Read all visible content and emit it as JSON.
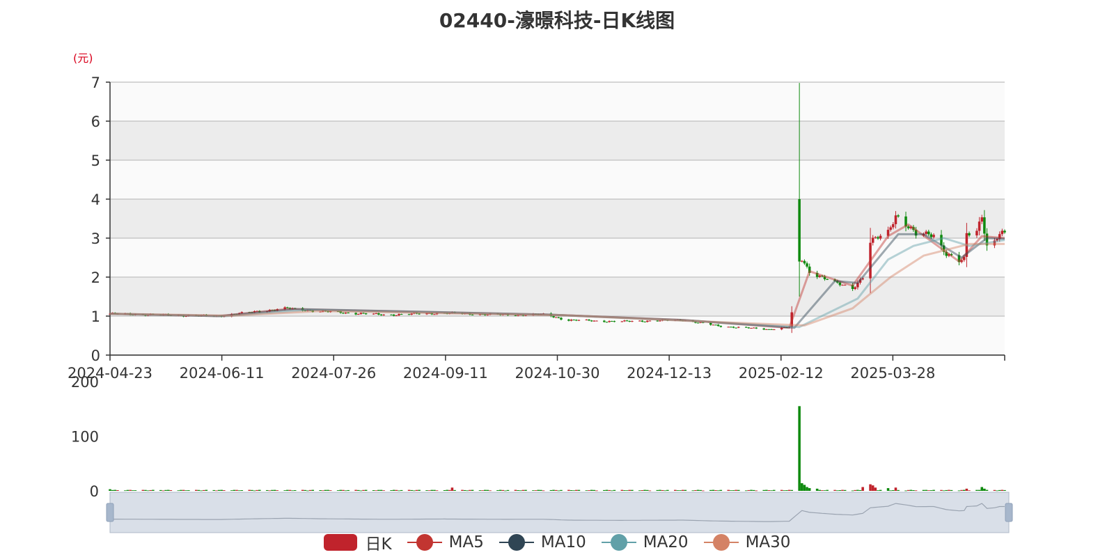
{
  "title": "02440-濠暻科技-日K线图",
  "unit_label": "(元)",
  "legend": [
    {
      "name": "日K",
      "color": "#c0232c",
      "kind": "rect"
    },
    {
      "name": "MA5",
      "color": "#c23531",
      "kind": "line"
    },
    {
      "name": "MA10",
      "color": "#2f4554",
      "kind": "line"
    },
    {
      "name": "MA20",
      "color": "#61a0a8",
      "kind": "line"
    },
    {
      "name": "MA30",
      "color": "#d48265",
      "kind": "line"
    }
  ],
  "chart_data": {
    "type": "candlestick",
    "title": "02440-濠暻科技-日K线图",
    "ylabel": "(元)",
    "ylim": [
      0,
      7
    ],
    "y_ticks": [
      "0",
      "1",
      "2",
      "3",
      "4",
      "5",
      "6",
      "7"
    ],
    "x_tick_labels": [
      "2024-04-23",
      "2024-06-11",
      "2024-07-26",
      "2024-09-11",
      "2024-10-30",
      "2024-12-13",
      "2025-02-12",
      "2025-03-28"
    ],
    "x_start": "2024-04-23",
    "x_end": "2025-04-11",
    "up_color": "#c0232c",
    "down_color": "#0f8a0f",
    "price_anchors": [
      [
        "2024-04-23",
        1.06
      ],
      [
        "2024-05-20",
        1.02
      ],
      [
        "2024-06-05",
        1.0
      ],
      [
        "2024-06-20",
        1.12
      ],
      [
        "2024-07-02",
        1.2
      ],
      [
        "2024-07-15",
        1.12
      ],
      [
        "2024-08-10",
        1.03
      ],
      [
        "2024-09-01",
        1.08
      ],
      [
        "2024-09-25",
        1.03
      ],
      [
        "2024-10-12",
        1.04
      ],
      [
        "2024-10-20",
        0.9
      ],
      [
        "2024-11-10",
        0.86
      ],
      [
        "2024-12-05",
        0.9
      ],
      [
        "2024-12-20",
        0.74
      ],
      [
        "2025-01-08",
        0.66
      ],
      [
        "2025-01-16",
        0.72
      ],
      [
        "2025-01-21",
        2.45
      ],
      [
        "2025-01-24",
        2.15
      ],
      [
        "2025-02-03",
        1.85
      ],
      [
        "2025-02-10",
        1.72
      ],
      [
        "2025-02-14",
        2.0
      ],
      [
        "2025-02-17",
        2.9
      ],
      [
        "2025-02-24",
        3.15
      ],
      [
        "2025-02-27",
        3.6
      ],
      [
        "2025-03-04",
        3.3
      ],
      [
        "2025-03-07",
        3.08
      ],
      [
        "2025-03-14",
        3.1
      ],
      [
        "2025-03-19",
        2.6
      ],
      [
        "2025-03-24",
        2.4
      ],
      [
        "2025-03-26",
        2.45
      ],
      [
        "2025-03-27",
        3.1
      ],
      [
        "2025-03-31",
        3.2
      ],
      [
        "2025-04-02",
        3.6
      ],
      [
        "2025-04-04",
        2.8
      ],
      [
        "2025-04-07",
        2.9
      ],
      [
        "2025-04-09",
        3.1
      ],
      [
        "2025-04-11",
        3.1
      ]
    ],
    "spike": {
      "date": "2025-01-20",
      "open": 4.0,
      "close": 2.4,
      "high": 6.98,
      "low": 1.5
    },
    "moving_averages": {
      "MA5": [
        [
          "2024-04-23",
          1.06
        ],
        [
          "2024-06-05",
          1.0
        ],
        [
          "2024-07-02",
          1.18
        ],
        [
          "2024-10-12",
          1.04
        ],
        [
          "2024-12-05",
          0.9
        ],
        [
          "2025-01-16",
          0.7
        ],
        [
          "2025-01-24",
          2.15
        ],
        [
          "2025-02-10",
          1.78
        ],
        [
          "2025-02-24",
          3.05
        ],
        [
          "2025-03-04",
          3.35
        ],
        [
          "2025-03-24",
          2.4
        ],
        [
          "2025-04-02",
          3.05
        ],
        [
          "2025-04-11",
          3.0
        ]
      ],
      "MA10": [
        [
          "2024-04-23",
          1.06
        ],
        [
          "2024-06-05",
          1.0
        ],
        [
          "2024-07-05",
          1.18
        ],
        [
          "2024-10-12",
          1.04
        ],
        [
          "2024-12-05",
          0.9
        ],
        [
          "2025-01-18",
          0.7
        ],
        [
          "2025-02-03",
          1.9
        ],
        [
          "2025-02-12",
          1.85
        ],
        [
          "2025-02-28",
          3.1
        ],
        [
          "2025-03-10",
          3.1
        ],
        [
          "2025-03-25",
          2.5
        ],
        [
          "2025-04-04",
          3.0
        ],
        [
          "2025-04-11",
          2.98
        ]
      ],
      "MA20": [
        [
          "2024-04-23",
          1.06
        ],
        [
          "2024-06-08",
          1.0
        ],
        [
          "2024-07-10",
          1.16
        ],
        [
          "2024-10-15",
          1.03
        ],
        [
          "2024-12-08",
          0.88
        ],
        [
          "2025-01-20",
          0.72
        ],
        [
          "2025-02-12",
          1.45
        ],
        [
          "2025-02-24",
          2.45
        ],
        [
          "2025-03-06",
          2.8
        ],
        [
          "2025-03-18",
          3.0
        ],
        [
          "2025-03-28",
          2.8
        ],
        [
          "2025-04-11",
          2.95
        ]
      ],
      "MA30": [
        [
          "2024-04-23",
          1.06
        ],
        [
          "2024-06-10",
          1.01
        ],
        [
          "2024-07-15",
          1.13
        ],
        [
          "2024-10-20",
          1.02
        ],
        [
          "2024-12-10",
          0.87
        ],
        [
          "2025-01-22",
          0.76
        ],
        [
          "2025-02-10",
          1.2
        ],
        [
          "2025-02-25",
          2.0
        ],
        [
          "2025-03-10",
          2.55
        ],
        [
          "2025-03-28",
          2.85
        ],
        [
          "2025-04-11",
          2.85
        ]
      ]
    },
    "volume": {
      "ylim": [
        0,
        200
      ],
      "y_ticks": [
        "0",
        "100",
        "200"
      ],
      "base": 1.2,
      "notable": [
        {
          "date": "2024-04-23",
          "value": 3,
          "dir": "down"
        },
        {
          "date": "2024-09-05",
          "value": 6,
          "dir": "up"
        },
        {
          "date": "2025-01-20",
          "value": 155,
          "dir": "down"
        },
        {
          "date": "2025-01-21",
          "value": 14,
          "dir": "down"
        },
        {
          "date": "2025-01-22",
          "value": 11,
          "dir": "down"
        },
        {
          "date": "2025-01-23",
          "value": 7,
          "dir": "down"
        },
        {
          "date": "2025-01-24",
          "value": 5,
          "dir": "down"
        },
        {
          "date": "2025-01-27",
          "value": 4,
          "dir": "down"
        },
        {
          "date": "2025-02-14",
          "value": 7,
          "dir": "up"
        },
        {
          "date": "2025-02-17",
          "value": 12,
          "dir": "up"
        },
        {
          "date": "2025-02-18",
          "value": 10,
          "dir": "up"
        },
        {
          "date": "2025-02-19",
          "value": 6,
          "dir": "up"
        },
        {
          "date": "2025-02-24",
          "value": 5,
          "dir": "down"
        },
        {
          "date": "2025-02-27",
          "value": 6,
          "dir": "up"
        },
        {
          "date": "2025-03-27",
          "value": 4,
          "dir": "up"
        },
        {
          "date": "2025-04-02",
          "value": 7,
          "dir": "down"
        },
        {
          "date": "2025-04-03",
          "value": 4,
          "dir": "down"
        }
      ]
    }
  }
}
